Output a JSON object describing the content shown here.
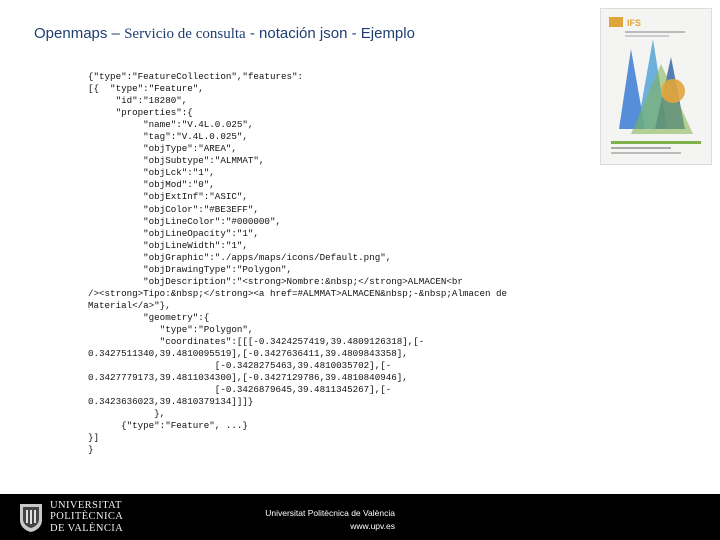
{
  "header": {
    "title_part1": "Openmaps – ",
    "title_part2": "Servicio de consulta",
    "title_part3": " - notación json - Ejemplo"
  },
  "cover_image": {
    "badge_text": "IFS",
    "colors": [
      "#3a7bd5",
      "#7fb24c",
      "#e2a53b",
      "#4b9fd6"
    ]
  },
  "code_sample": {
    "text": "{\"type\":\"FeatureCollection\",\"features\":\n[{  \"type\":\"Feature\",\n     \"id\":\"18280\",\n     \"properties\":{\n          \"name\":\"V.4L.0.025\",\n          \"tag\":\"V.4L.0.025\",\n          \"objType\":\"AREA\",\n          \"objSubtype\":\"ALMMAT\",\n          \"objLck\":\"1\",\n          \"objMod\":\"0\",\n          \"objExtInf\":\"ASIC\",\n          \"objColor\":\"#BE3EFF\",\n          \"objLineColor\":\"#000000\",\n          \"objLineOpacity\":\"1\",\n          \"objLineWidth\":\"1\",\n          \"objGraphic\":\"./apps/maps/icons/Default.png\",\n          \"objDrawingType\":\"Polygon\",\n          \"objDescription\":\"<strong>Nombre:&nbsp;</strong>ALMACEN<br\n/><strong>Tipo:&nbsp;</strong><a href=#ALMMAT>ALMACEN&nbsp;-&nbsp;Almacen de\nMaterial</a>\"},\n          \"geometry\":{\n             \"type\":\"Polygon\",\n             \"coordinates\":[[[-0.3424257419,39.4809126318],[-\n0.3427511340,39.4810095519],[-0.3427636411,39.4809843358],\n                       [-0.3428275463,39.4810035702],[-\n0.3427779173,39.4811034300],[-0.3427129786,39.4810840946],\n                       [-0.3426879645,39.4811345267],[-\n0.3423636023,39.4810379134]]]}\n            },\n      {\"type\":\"Feature\", ...}\n}]\n}"
  },
  "footer": {
    "logo_lines": [
      "UNIVERSITAT",
      "POLITÈCNICA",
      "DE VALÈNCIA"
    ],
    "institution": "Universitat Politècnica de València",
    "url": "www.upv.es"
  }
}
